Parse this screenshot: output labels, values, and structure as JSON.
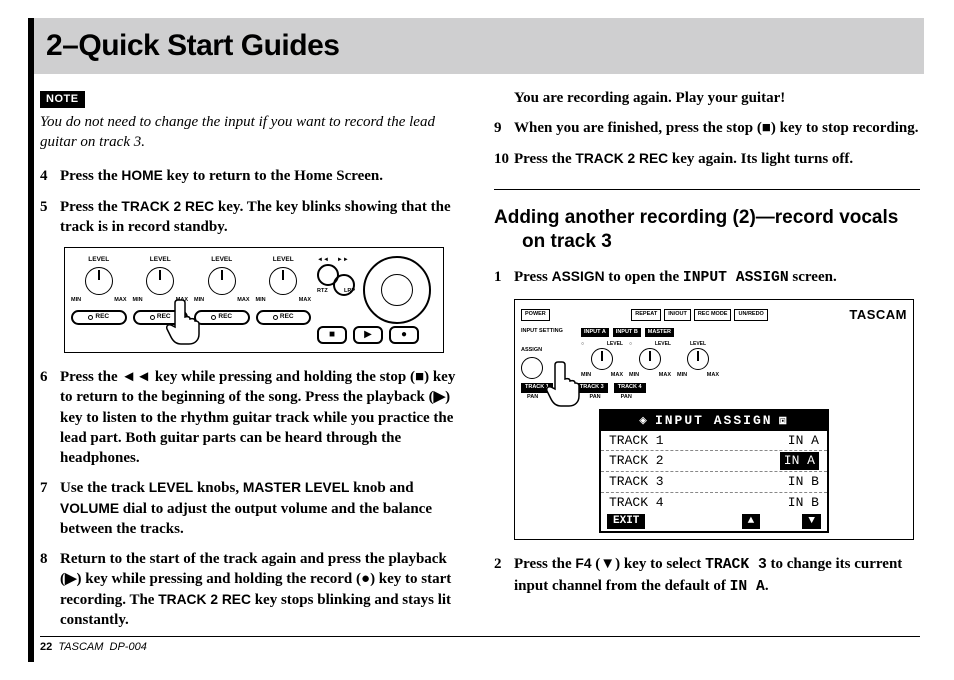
{
  "title": "2–Quick Start Guides",
  "note_tag": "NOTE",
  "note_text": "You do not need to change the input if you want to record the lead guitar on track 3.",
  "left_steps": {
    "s4": {
      "pre": "Press the ",
      "key": "HOME",
      "post": " key to return to the Home Screen."
    },
    "s5": {
      "pre": "Press the ",
      "key": "TRACK 2 REC",
      "post": " key. The key blinks showing that the track is in record standby."
    },
    "s6": "Press the ◄◄ key while pressing and holding the stop (■) key to return to the beginning of the song. Press the playback (▶) key to listen to the rhythm guitar track while you practice the lead part. Both guitar parts can be heard through the headphones.",
    "s7": {
      "pre": "Use the track ",
      "k1": "LEVEL",
      "mid1": " knobs, ",
      "k2": "MASTER LEVEL",
      "mid2": " knob and ",
      "k3": "VOLUME",
      "post": " dial to adjust the output volume and the balance between the tracks."
    },
    "s8": {
      "pre": "Return to the start of the track again and press the playback (▶) key while pressing and holding the record (●) key to start recording. The ",
      "key": "TRACK 2 REC",
      "post": " key stops blinking and stays lit constantly."
    }
  },
  "right_top": {
    "lead": "You are recording again. Play your guitar!",
    "s9": "When you are finished, press the stop (■) key to stop recording.",
    "s10": {
      "pre": "Press the ",
      "key": "TRACK 2 REC",
      "post": " key again. Its light turns off."
    }
  },
  "subheading_line1": "Adding another recording (2)—record vocals",
  "subheading_line2": "on track 3",
  "right_steps": {
    "s1": {
      "pre": "Press ",
      "key": "ASSIGN",
      "mid": " to open the ",
      "mono": "INPUT ASSIGN",
      "post": " screen."
    },
    "s2": {
      "pre": "Press the ",
      "key": "F4",
      "sym": " (▼) key to select ",
      "mono1": "TRACK 3",
      "mid": " to change its current input channel from the default of ",
      "mono2": "IN A",
      "post": "."
    }
  },
  "diagram1": {
    "level": "LEVEL",
    "min": "MIN",
    "max": "MAX",
    "rec": "REC",
    "rtz": "RTZ",
    "lrp": "LRP"
  },
  "diagram2": {
    "power": "POWER",
    "repeat": "REPEAT",
    "inout": "IN/OUT",
    "recmode": "REC MODE",
    "unredo": "UN/REDO",
    "brand": "TASCAM",
    "input_setting": "INPUT SETTING",
    "input_a": "INPUT A",
    "input_b": "INPUT B",
    "master": "MASTER",
    "level": "LEVEL",
    "ol": "OL",
    "min": "MIN",
    "max": "MAX",
    "assign": "ASSIGN",
    "track1": "TRACK 1",
    "track2": "TRACK 2",
    "track3": "TRACK 3",
    "track4": "TRACK 4",
    "pan": "PAN"
  },
  "screen": {
    "title": "INPUT ASSIGN",
    "rows": [
      {
        "trk": "TRACK 1",
        "val": "IN A",
        "sel": false
      },
      {
        "trk": "TRACK 2",
        "val": "IN A",
        "sel": true
      },
      {
        "trk": "TRACK 3",
        "val": "IN B",
        "sel": false
      },
      {
        "trk": "TRACK 4",
        "val": "IN B",
        "sel": false
      }
    ],
    "exit": "EXIT",
    "up": "▲",
    "down": "▼"
  },
  "footer": {
    "page": "22",
    "brand": "TASCAM",
    "model": "DP-004"
  }
}
